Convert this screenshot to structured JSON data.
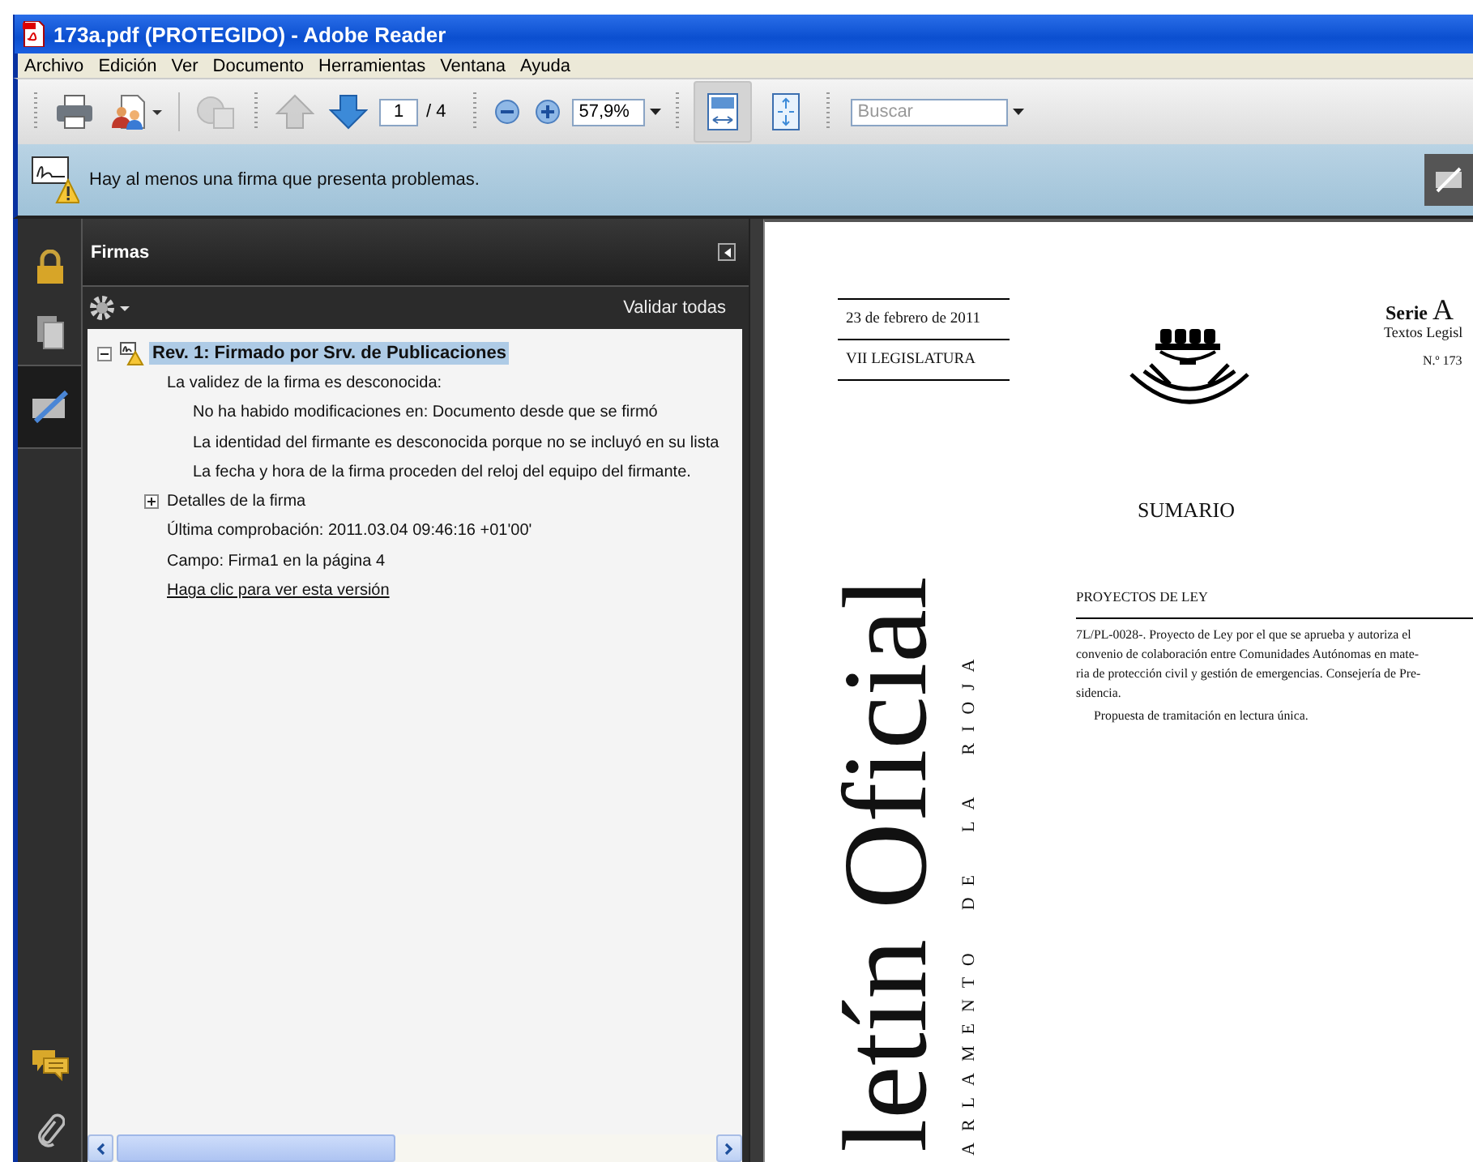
{
  "window": {
    "title": "173a.pdf (PROTEGIDO) - Adobe Reader"
  },
  "menu": [
    "Archivo",
    "Edición",
    "Ver",
    "Documento",
    "Herramientas",
    "Ventana",
    "Ayuda"
  ],
  "toolbar": {
    "review": {
      "disabled": true
    },
    "page_up": {
      "disabled": true
    },
    "page_down": {
      "disabled": false
    },
    "page_field": "1",
    "page_total": "/ 4",
    "zoom_field": "57,9%",
    "fit_width": {
      "selected": true
    },
    "fit_page": {
      "selected": false
    },
    "search": {
      "placeholder": "Buscar"
    }
  },
  "message_bar": {
    "text": "Hay al menos una firma que presenta problemas."
  },
  "navigation_top": [
    {
      "kind": "lock",
      "selected": false
    },
    {
      "kind": "pages",
      "selected": false
    },
    {
      "kind": "signatures",
      "selected": true
    }
  ],
  "navigation_bottom": [
    {
      "kind": "comments",
      "selected": false
    },
    {
      "kind": "attachments",
      "selected": false
    }
  ],
  "panel": {
    "title": "Firmas",
    "validate_all": "Validar todas"
  },
  "signatures": [
    {
      "label": "Rev. 1: Firmado por Srv. de Publicaciones",
      "kind": "signature",
      "expanded": true,
      "selected": true,
      "children": [
        {
          "label": "La validez de la firma es desconocida:",
          "kind": "text",
          "children": [
            {
              "label": "No ha habido modificaciones en: Documento desde que se firmó",
              "kind": "text"
            },
            {
              "label": "La identidad del firmante es desconocida porque no se incluyó en su lista",
              "kind": "text"
            },
            {
              "label": "La fecha y hora de la firma proceden del reloj del equipo del firmante.",
              "kind": "text"
            }
          ]
        },
        {
          "label": "Detalles de la firma",
          "kind": "group",
          "expanded": false
        },
        {
          "label": "Última comprobación: 2011.03.04 09:46:16 +01'00'",
          "kind": "text"
        },
        {
          "label": "Campo: Firma1 en la página 4",
          "kind": "text"
        },
        {
          "label": "Haga clic para ver esta versión",
          "kind": "link"
        }
      ]
    }
  ],
  "document": {
    "date": "23 de febrero de 2011",
    "legislature": "VII  LEGISLATURA",
    "series_label": "Serie",
    "series_letter": "A",
    "series_subtitle": "Textos Legisl",
    "number": "N.º 173",
    "masthead": "letín Oficial",
    "masthead_sub": "ARLAMENTO  DE  LA  RIOJA",
    "heading": "SUMARIO",
    "section": "PROYECTOS DE LEY",
    "item_lines": [
      "7L/PL-0028-. Proyecto de Ley por el que se aprueba y autoriza el",
      "convenio de colaboración entre Comunidades Autónomas en mate-",
      "ria de protección civil y gestión de emergencias. Consejería de Pre-",
      "sidencia."
    ],
    "item_note": "Propuesta de tramitación en lectura única."
  }
}
